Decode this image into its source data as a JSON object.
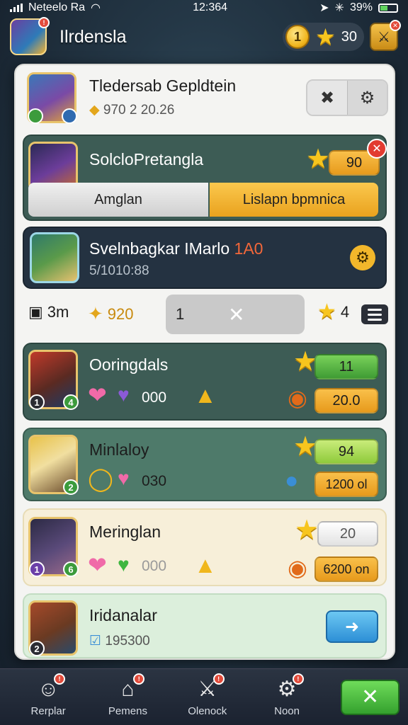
{
  "status_bar": {
    "carrier": "Neteelo Ra",
    "time": "12:364",
    "battery": "39%"
  },
  "header": {
    "title": "Ilrdensla",
    "coin_value": "1",
    "star_value": "30"
  },
  "profile_card": {
    "title": "Tledersab Gepldtein",
    "subtitle": "970 2 20.26"
  },
  "challenge_card": {
    "title": "SolcloPretangla",
    "star_value": "90",
    "left_button": "Amglan",
    "right_button": "Lislapn bpmnica"
  },
  "event_card": {
    "title": "Svelnbagkar IMarlo",
    "highlight": "1A0",
    "subtitle": "5/1010:88"
  },
  "filter_bar": {
    "count_label": "3m",
    "gold_value": "920",
    "search_value": "1",
    "star_value": "4"
  },
  "heroes": [
    {
      "name": "Ooringdals",
      "value": "000",
      "star_value": "11",
      "resource_value": "20.0",
      "level_left": "1",
      "level_right": "4"
    },
    {
      "name": "Minlaloy",
      "value": "030",
      "star_value": "94",
      "resource_value": "1200 ol",
      "level_right": "2"
    },
    {
      "name": "Meringlan",
      "value": "000",
      "star_value": "20",
      "resource_value": "6200 on",
      "level_left": "1",
      "level_right": "6"
    },
    {
      "name": "Iridanalar",
      "value": "195300",
      "level_left": "2"
    }
  ],
  "nav": [
    {
      "label": "Rerplar",
      "icon": "hero-icon"
    },
    {
      "label": "Pemens",
      "icon": "home-icon"
    },
    {
      "label": "Olenock",
      "icon": "sword-icon"
    },
    {
      "label": "Noon",
      "icon": "gear-icon"
    }
  ],
  "colors": {
    "accent_orange": "#e9a21e",
    "accent_green": "#3f9c34",
    "accent_red": "#e23b30",
    "accent_blue": "#2d8fd6",
    "dark_card": "#243241",
    "teal_card": "#3d5c55"
  }
}
